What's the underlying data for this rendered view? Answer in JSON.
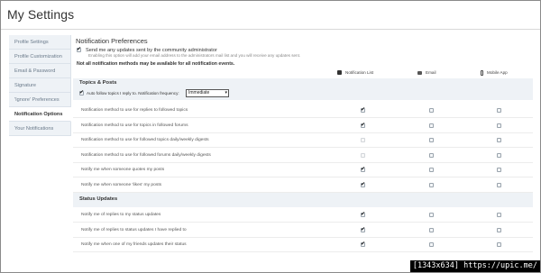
{
  "page": {
    "title": "My Settings"
  },
  "sidebar": {
    "items": [
      {
        "label": "Profile Settings"
      },
      {
        "label": "Profile Customization"
      },
      {
        "label": "Email & Password"
      },
      {
        "label": "Signature"
      },
      {
        "label": "'Ignore' Preferences"
      },
      {
        "label": "Notification Options",
        "active": true
      },
      {
        "label": "Your Notifications"
      }
    ]
  },
  "prefs": {
    "title": "Notification Preferences",
    "admin_label": "Send me any updates sent by the community administrator",
    "admin_checked": true,
    "admin_desc": "Enabling this option will add your email address to the administrators mail list and you will receive any updates sent.",
    "note": "Not all notification methods may be available for all notification events.",
    "columns": [
      {
        "label": "Notification List",
        "icon": "bell-icon"
      },
      {
        "label": "Email",
        "icon": "envelope-icon"
      },
      {
        "label": "Mobile App",
        "icon": "phone-icon"
      }
    ]
  },
  "topics": {
    "title": "Topics & Posts",
    "follow_label": "Auto follow topics I reply to.  Notification frequency:",
    "follow_checked": true,
    "frequency": "Immediate",
    "rows": [
      {
        "label": "Notification method to use for replies to followed topics",
        "checks": [
          true,
          false,
          false
        ],
        "disabled": [
          false,
          false,
          false
        ]
      },
      {
        "label": "Notification method to use for topics in followed forums",
        "checks": [
          true,
          false,
          false
        ],
        "disabled": [
          false,
          false,
          false
        ]
      },
      {
        "label": "Notification method to use for followed topics daily/weekly digests",
        "checks": [
          false,
          false,
          false
        ],
        "disabled": [
          true,
          false,
          false
        ]
      },
      {
        "label": "Notification method to use for followed forums daily/weekly digests",
        "checks": [
          false,
          false,
          false
        ],
        "disabled": [
          true,
          false,
          false
        ]
      },
      {
        "label": "Notify me when someone quotes my posts",
        "checks": [
          true,
          false,
          false
        ],
        "disabled": [
          false,
          false,
          false
        ]
      },
      {
        "label": "Notify me when someone 'likes' my posts",
        "checks": [
          true,
          false,
          false
        ],
        "disabled": [
          false,
          false,
          false
        ]
      }
    ]
  },
  "status": {
    "title": "Status Updates",
    "rows": [
      {
        "label": "Notify me of replies to my status updates",
        "checks": [
          true,
          false,
          false
        ],
        "disabled": [
          false,
          false,
          false
        ]
      },
      {
        "label": "Notify me of replies to status updates I have replied to",
        "checks": [
          true,
          false,
          false
        ],
        "disabled": [
          false,
          false,
          false
        ]
      },
      {
        "label": "Notify me when one of my friends updates their status",
        "checks": [
          true,
          false,
          false
        ],
        "disabled": [
          false,
          false,
          false
        ]
      }
    ]
  },
  "watermark": {
    "text": "[1343x634] https://upic.me/"
  }
}
